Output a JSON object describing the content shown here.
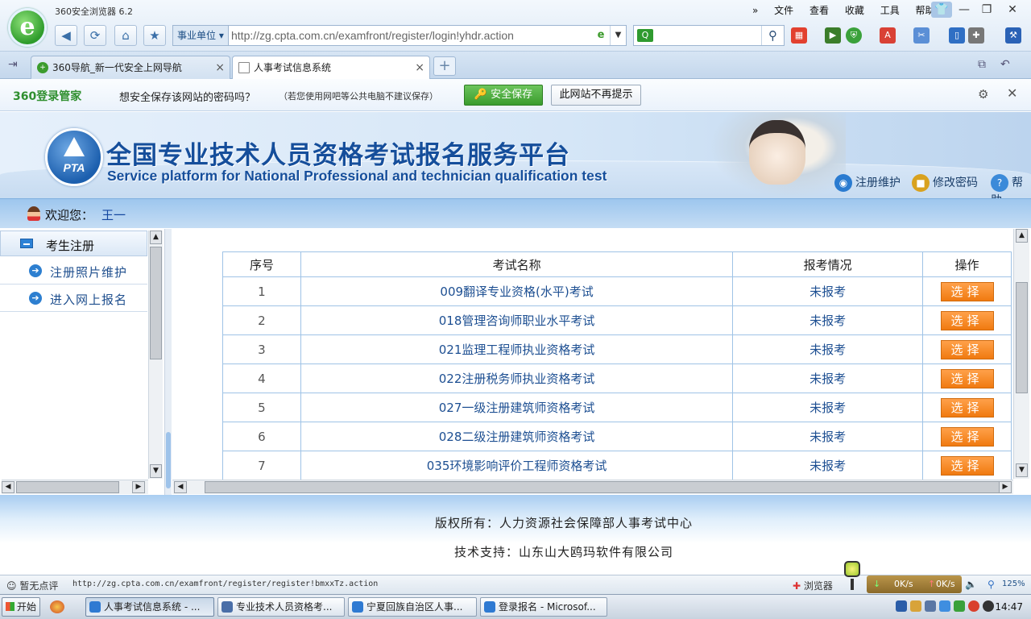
{
  "browser": {
    "app_title": "360安全浏览器 6.2",
    "logo_glyph": "e",
    "address_prefix": "事业单位",
    "address_url": "http://zg.cpta.com.cn/examfront/register/login!yhdr.action",
    "menu": [
      "文件",
      "查看",
      "收藏",
      "工具",
      "帮助"
    ],
    "menu_more": "»"
  },
  "tabs": [
    {
      "label": "360导航_新一代安全上网导航",
      "active": false
    },
    {
      "label": "人事考试信息系统",
      "active": true
    }
  ],
  "password_bar": {
    "brand": "360登录管家",
    "question": "想安全保存该网站的密码吗？",
    "hint": "（若您使用网吧等公共电脑不建议保存）",
    "save_label": "安全保存",
    "never_label": "此网站不再提示"
  },
  "banner": {
    "logo_text": "PTA",
    "title": "全国专业技术人员资格考试报名服务平台",
    "subtitle": "Service platform for National Professional and technician qualification test",
    "links": [
      {
        "label": "注册维护",
        "icon": "globe-icon"
      },
      {
        "label": "修改密码",
        "icon": "lock-icon"
      },
      {
        "label": "帮助",
        "icon": "help-icon"
      }
    ]
  },
  "welcome": {
    "label": "欢迎您：",
    "name": "王一"
  },
  "sidebar": {
    "header": "考生注册",
    "items": [
      {
        "label": "注册照片维护"
      },
      {
        "label": "进入网上报名"
      }
    ]
  },
  "table": {
    "headers": [
      "序号",
      "考试名称",
      "报考情况",
      "操作"
    ],
    "action_label": "选择",
    "rows": [
      {
        "seq": "1",
        "name": "009翻译专业资格(水平)考试",
        "status": "未报考"
      },
      {
        "seq": "2",
        "name": "018管理咨询师职业水平考试",
        "status": "未报考"
      },
      {
        "seq": "3",
        "name": "021监理工程师执业资格考试",
        "status": "未报考"
      },
      {
        "seq": "4",
        "name": "022注册税务师执业资格考试",
        "status": "未报考"
      },
      {
        "seq": "5",
        "name": "027一级注册建筑师资格考试",
        "status": "未报考"
      },
      {
        "seq": "6",
        "name": "028二级注册建筑师资格考试",
        "status": "未报考"
      },
      {
        "seq": "7",
        "name": "035环境影响评价工程师资格考试",
        "status": "未报考"
      }
    ]
  },
  "footer": {
    "copyright": "版权所有：人力资源社会保障部人事考试中心",
    "support": "技术支持：山东山大鸥玛软件有限公司"
  },
  "statusbar": {
    "rating": "暂无点评",
    "url": "http://zg.cpta.com.cn/examfront/register/register!bmxxTz.action",
    "browser_label": "浏览器",
    "down_speed": "0K/s",
    "up_speed": "0K/s",
    "zoom": "125%"
  },
  "taskbar": {
    "start": "开始",
    "tasks": [
      {
        "label": "人事考试信息系统 - ...",
        "active": true
      },
      {
        "label": "专业技术人员资格考...",
        "active": false
      },
      {
        "label": "宁夏回族自治区人事...",
        "active": false
      },
      {
        "label": "登录报名 - Microsof...",
        "active": false
      }
    ],
    "clock": "14:47"
  },
  "colors": {
    "brand_blue": "#154e9b",
    "link_blue": "#1d4f92",
    "select_button": "#f07a10",
    "save_button": "#3a9c2e"
  }
}
